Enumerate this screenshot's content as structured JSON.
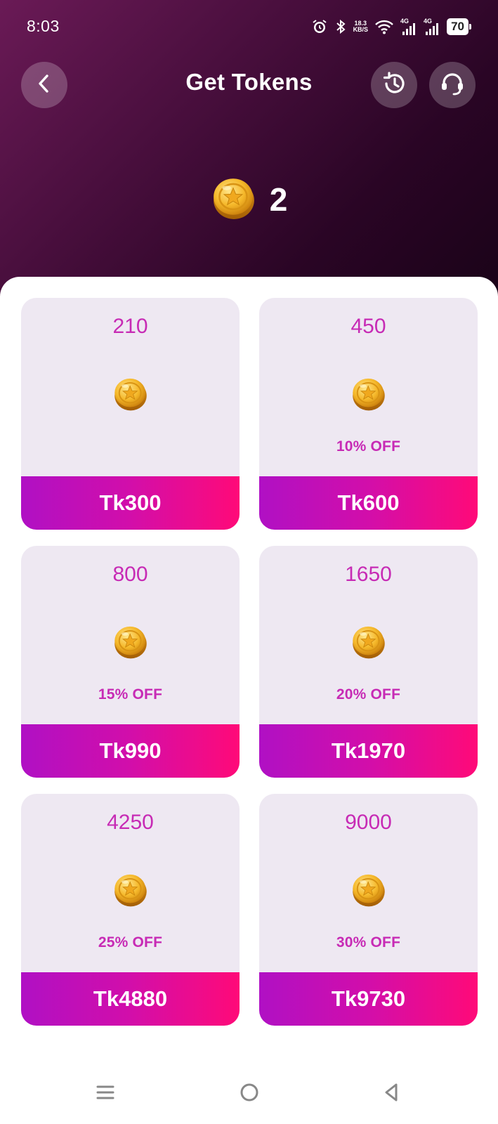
{
  "status": {
    "time": "8:03",
    "net_speed_top": "18.3",
    "net_speed_unit": "KB/S",
    "sim1": "4G",
    "sim2": "4G",
    "battery": "70"
  },
  "header": {
    "title": "Get Tokens",
    "back_icon": "chevron-left-icon",
    "history_icon": "history-icon",
    "support_icon": "headset-icon"
  },
  "balance": {
    "value": "2",
    "icon": "coin-icon"
  },
  "packages": [
    {
      "amount": "210",
      "discount": "",
      "price": "Tk300"
    },
    {
      "amount": "450",
      "discount": "10% OFF",
      "price": "Tk600"
    },
    {
      "amount": "800",
      "discount": "15% OFF",
      "price": "Tk990"
    },
    {
      "amount": "1650",
      "discount": "20% OFF",
      "price": "Tk1970"
    },
    {
      "amount": "4250",
      "discount": "25% OFF",
      "price": "Tk4880"
    },
    {
      "amount": "9000",
      "discount": "30% OFF",
      "price": "Tk9730"
    }
  ],
  "colors": {
    "accent_text": "#c72bb5",
    "price_gradient_start": "#b010c4",
    "price_gradient_end": "#ff0a78",
    "card_bg": "#eee8f2",
    "header_dark": "#2a0525"
  },
  "navbar": {
    "menu_icon": "menu-icon",
    "home_icon": "home-circle-icon",
    "back_icon": "back-triangle-icon"
  }
}
